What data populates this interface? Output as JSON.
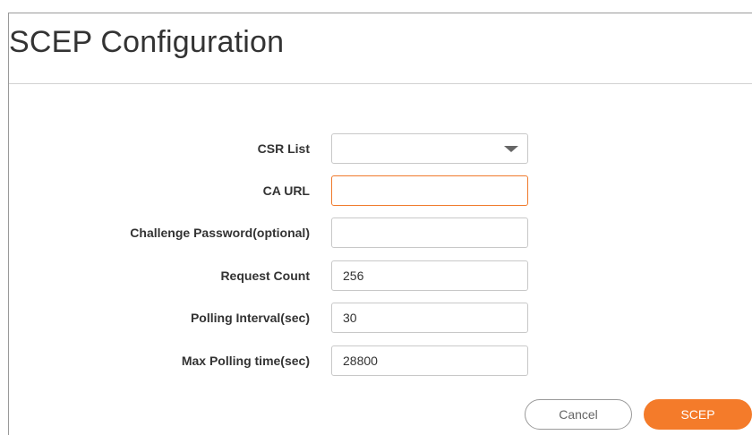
{
  "page": {
    "title": "SCEP Configuration"
  },
  "form": {
    "csr_list": {
      "label": "CSR List",
      "value": ""
    },
    "ca_url": {
      "label": "CA URL",
      "value": ""
    },
    "challenge_password": {
      "label": "Challenge Password(optional)",
      "value": ""
    },
    "request_count": {
      "label": "Request Count",
      "value": "256"
    },
    "polling_interval": {
      "label": "Polling Interval(sec)",
      "value": "30"
    },
    "max_polling_time": {
      "label": "Max Polling time(sec)",
      "value": "28800"
    }
  },
  "actions": {
    "cancel_label": "Cancel",
    "scep_label": "SCEP"
  },
  "colors": {
    "accent": "#f47b2a",
    "focus_border": "#f07a2c"
  },
  "icons": {
    "select_caret": "caret-down-icon"
  }
}
